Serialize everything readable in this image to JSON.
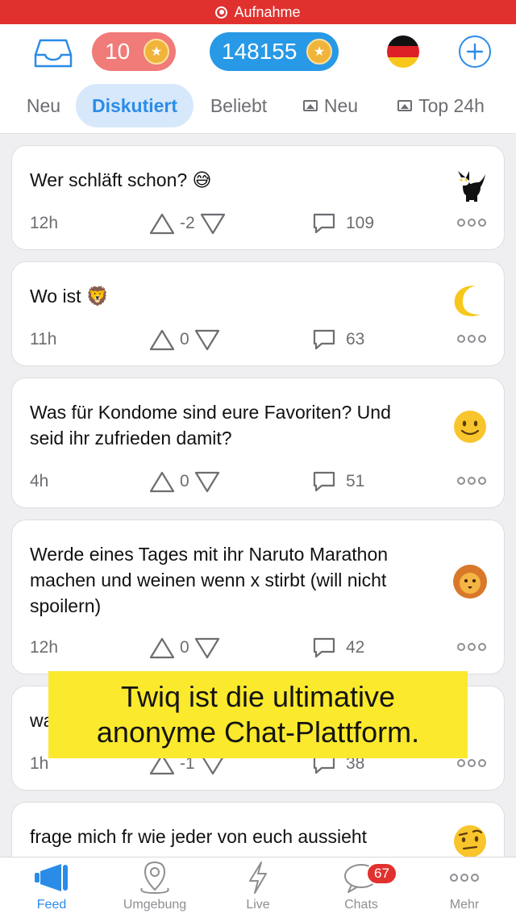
{
  "recording": {
    "label": "Aufnahme"
  },
  "header": {
    "karma": "10",
    "points": "148155",
    "tabs": [
      {
        "label": "Neu",
        "active": false,
        "icon": ""
      },
      {
        "label": "Diskutiert",
        "active": true,
        "icon": ""
      },
      {
        "label": "Beliebt",
        "active": false,
        "icon": ""
      },
      {
        "label": "Neu",
        "active": false,
        "icon": "image-icon"
      },
      {
        "label": "Top 24h",
        "active": false,
        "icon": "image-icon"
      }
    ]
  },
  "posts": [
    {
      "text": "Wer schläft schon? 😅",
      "emoji": "cat-icon",
      "time": "12h",
      "votes": "-2",
      "comments": "109"
    },
    {
      "text": "Wo ist 🦁",
      "emoji": "moon-icon",
      "time": "11h",
      "votes": "0",
      "comments": "63"
    },
    {
      "text": "Was für Kondome sind eure Favoriten? Und seid ihr zufrieden damit?",
      "emoji": "smiley-icon",
      "time": "4h",
      "votes": "0",
      "comments": "51"
    },
    {
      "text": "Werde eines Tages mit ihr Naruto Marathon machen und weinen wenn x stirbt (will nicht spoilern)",
      "emoji": "lion-icon",
      "time": "12h",
      "votes": "0",
      "comments": "42"
    },
    {
      "text": "wa",
      "emoji": "",
      "time": "1h",
      "votes": "-1",
      "comments": "38"
    },
    {
      "text": "frage mich fr wie jeder von euch aussieht",
      "emoji": "raised-eyebrow-icon",
      "time": "",
      "votes": "",
      "comments": ""
    }
  ],
  "overlay": {
    "line1": "Twiq ist die ultimative",
    "line2": "anonyme Chat-Plattform."
  },
  "tabbar": {
    "items": [
      {
        "label": "Feed",
        "icon": "megaphone-icon",
        "active": true
      },
      {
        "label": "Umgebung",
        "icon": "location-pin-icon",
        "active": false
      },
      {
        "label": "Live",
        "icon": "lightning-icon",
        "active": false
      },
      {
        "label": "Chats",
        "icon": "chat-bubble-icon",
        "active": false,
        "badge": "67"
      },
      {
        "label": "Mehr",
        "icon": "more-icon",
        "active": false
      }
    ]
  },
  "colors": {
    "accent": "#2b8ce8",
    "recording": "#e0312f",
    "karma": "#f07b78",
    "points": "#2899e6",
    "overlay": "#fbe92d"
  }
}
